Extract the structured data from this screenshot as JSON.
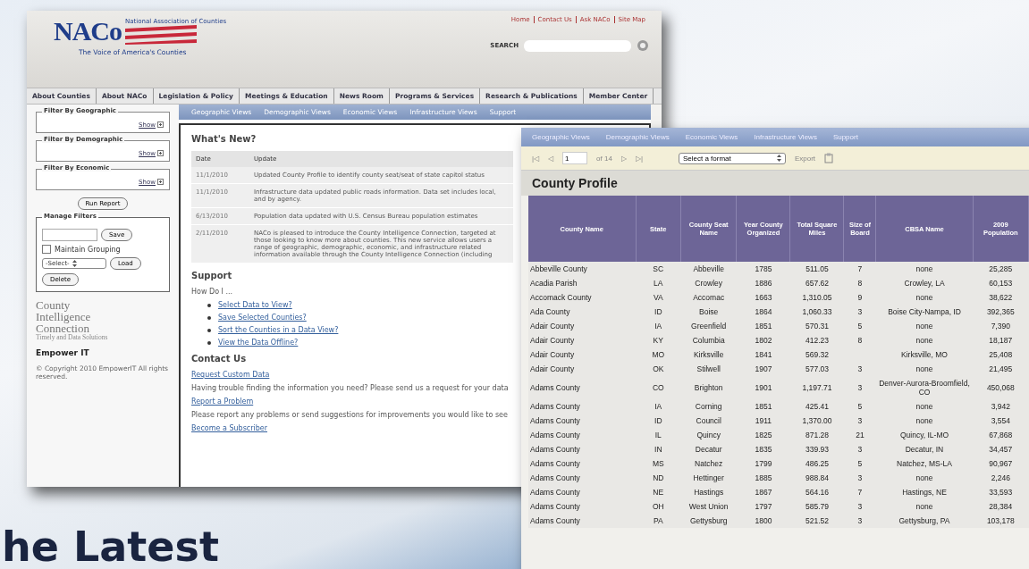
{
  "site_window": {
    "logo": {
      "mark": "NACo",
      "name": "National Association of Counties",
      "tagline": "The Voice of America's Counties"
    },
    "top_links": [
      "Home",
      "Contact Us",
      "Ask NACo",
      "Site Map"
    ],
    "search": {
      "label": "SEARCH"
    },
    "nav": [
      "About Counties",
      "About NACo",
      "Legislation & Policy",
      "Meetings & Education",
      "News Room",
      "Programs & Services",
      "Research & Publications",
      "Member Center"
    ],
    "subnav": [
      "Geographic Views",
      "Demographic Views",
      "Economic Views",
      "Infrastructure Views",
      "Support"
    ],
    "filters": [
      {
        "title": "Filter By Geographic",
        "action": "Show"
      },
      {
        "title": "Filter By Demographic",
        "action": "Show"
      },
      {
        "title": "Filter By Economic",
        "action": "Show"
      }
    ],
    "run_button": "Run Report",
    "manage": {
      "title": "Manage Filters",
      "save": "Save",
      "checkbox": {
        "label": "Maintain Grouping",
        "checked": false
      },
      "select": "-Select-",
      "load": "Load",
      "delete": "Delete"
    },
    "brand": {
      "lines": [
        "County",
        "Intelligence",
        "Connection"
      ],
      "sub": "Timely and Data Solutions",
      "partner": "Empower IT",
      "copyright": "© Copyright 2010 EmpowerIT All rights reserved."
    },
    "whats_new": {
      "title": "What's New?",
      "columns": [
        "Date",
        "Update"
      ],
      "rows": [
        {
          "date": "11/1/2010",
          "text": "Updated County Profile to identify county seat/seat of state capitol status"
        },
        {
          "date": "11/1/2010",
          "text": "Infrastructure data updated public roads information. Data set includes local, and by agency."
        },
        {
          "date": "6/13/2010",
          "text": "Population data updated with U.S. Census Bureau population estimates"
        },
        {
          "date": "2/11/2010",
          "text": "NACo is pleased to introduce the County Intelligence Connection, targeted at those looking to know more about counties. This new service allows users a range of geographic, demographic, economic, and infrastructure related information available through the County Intelligence Connection (including"
        }
      ]
    },
    "support": {
      "title": "Support",
      "intro": "How Do I ...",
      "links": [
        "Select Data to View?",
        "Save Selected Counties?",
        "Sort the Counties in a Data View?",
        "View the Data Offline?"
      ]
    },
    "contact": {
      "title": "Contact Us",
      "items": [
        {
          "link": "Request Custom Data",
          "text": "Having trouble finding the information you need? Please send us a request for your data"
        },
        {
          "link": "Report a Problem",
          "text": "Please report any problems or send suggestions for improvements you would like to see"
        },
        {
          "link": "Become a Subscriber"
        }
      ]
    }
  },
  "report_window": {
    "subnav": [
      "Geographic Views",
      "Demographic Views",
      "Economic Views",
      "Infrastructure Views",
      "Support"
    ],
    "pager": {
      "first": "|◁",
      "prev": "◁",
      "page": "1",
      "of": "of 14",
      "next": "▷",
      "last": "▷|"
    },
    "format_select": "Select a format",
    "export": "Export",
    "title": "County Profile",
    "columns": [
      "County Name",
      "State",
      "County Seat Name",
      "Year County Organized",
      "Total Square Miles",
      "Size of Board",
      "CBSA Name",
      "2009 Population"
    ],
    "rows": [
      [
        "Abbeville County",
        "SC",
        "Abbeville",
        "1785",
        "511.05",
        "7",
        "none",
        "25,285"
      ],
      [
        "Acadia Parish",
        "LA",
        "Crowley",
        "1886",
        "657.62",
        "8",
        "Crowley, LA",
        "60,153"
      ],
      [
        "Accomack County",
        "VA",
        "Accomac",
        "1663",
        "1,310.05",
        "9",
        "none",
        "38,622"
      ],
      [
        "Ada County",
        "ID",
        "Boise",
        "1864",
        "1,060.33",
        "3",
        "Boise City-Nampa, ID",
        "392,365"
      ],
      [
        "Adair County",
        "IA",
        "Greenfield",
        "1851",
        "570.31",
        "5",
        "none",
        "7,390"
      ],
      [
        "Adair County",
        "KY",
        "Columbia",
        "1802",
        "412.23",
        "8",
        "none",
        "18,187"
      ],
      [
        "Adair County",
        "MO",
        "Kirksville",
        "1841",
        "569.32",
        "",
        "Kirksville, MO",
        "25,408"
      ],
      [
        "Adair County",
        "OK",
        "Stilwell",
        "1907",
        "577.03",
        "3",
        "none",
        "21,495"
      ],
      [
        "Adams County",
        "CO",
        "Brighton",
        "1901",
        "1,197.71",
        "3",
        "Denver-Aurora-Broomfield, CO",
        "450,068"
      ],
      [
        "Adams County",
        "IA",
        "Corning",
        "1851",
        "425.41",
        "5",
        "none",
        "3,942"
      ],
      [
        "Adams County",
        "ID",
        "Council",
        "1911",
        "1,370.00",
        "3",
        "none",
        "3,554"
      ],
      [
        "Adams County",
        "IL",
        "Quincy",
        "1825",
        "871.28",
        "21",
        "Quincy, IL-MO",
        "67,868"
      ],
      [
        "Adams County",
        "IN",
        "Decatur",
        "1835",
        "339.93",
        "3",
        "Decatur, IN",
        "34,457"
      ],
      [
        "Adams County",
        "MS",
        "Natchez",
        "1799",
        "486.25",
        "5",
        "Natchez, MS-LA",
        "90,967"
      ],
      [
        "Adams County",
        "ND",
        "Hettinger",
        "1885",
        "988.84",
        "3",
        "none",
        "2,246"
      ],
      [
        "Adams County",
        "NE",
        "Hastings",
        "1867",
        "564.16",
        "7",
        "Hastings, NE",
        "33,593"
      ],
      [
        "Adams County",
        "OH",
        "West Union",
        "1797",
        "585.79",
        "3",
        "none",
        "28,384"
      ],
      [
        "Adams County",
        "PA",
        "Gettysburg",
        "1800",
        "521.52",
        "3",
        "Gettysburg, PA",
        "103,178"
      ]
    ]
  },
  "headline": "he Latest"
}
